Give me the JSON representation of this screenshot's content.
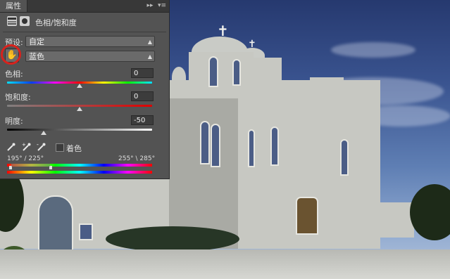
{
  "panel": {
    "tab_label": "属性",
    "collapse_glyph": "▸▸",
    "menu_glyph": "▾≡",
    "adjustment_title": "色相/饱和度",
    "preset_label": "预设:",
    "preset_value": "自定",
    "channel_value": "蓝色",
    "hue": {
      "label": "色相:",
      "value": "0",
      "level": 0.5
    },
    "saturation": {
      "label": "饱和度:",
      "value": "0",
      "level": 0.5
    },
    "lightness": {
      "label": "明度:",
      "value": "-50",
      "level": 0.25
    },
    "colorize_label": "着色",
    "range_left": "195° / 225°",
    "range_right": "255° \\ 285°",
    "icons": {
      "adjustment": "hue-saturation-icon",
      "mask": "layer-mask-icon",
      "hand": "targeted-adjustment-hand-icon",
      "eyedropper": "eyedropper-icon",
      "eyedropper_add": "eyedropper-plus-icon",
      "eyedropper_sub": "eyedropper-minus-icon"
    },
    "highlight_color": "#d8221d"
  }
}
